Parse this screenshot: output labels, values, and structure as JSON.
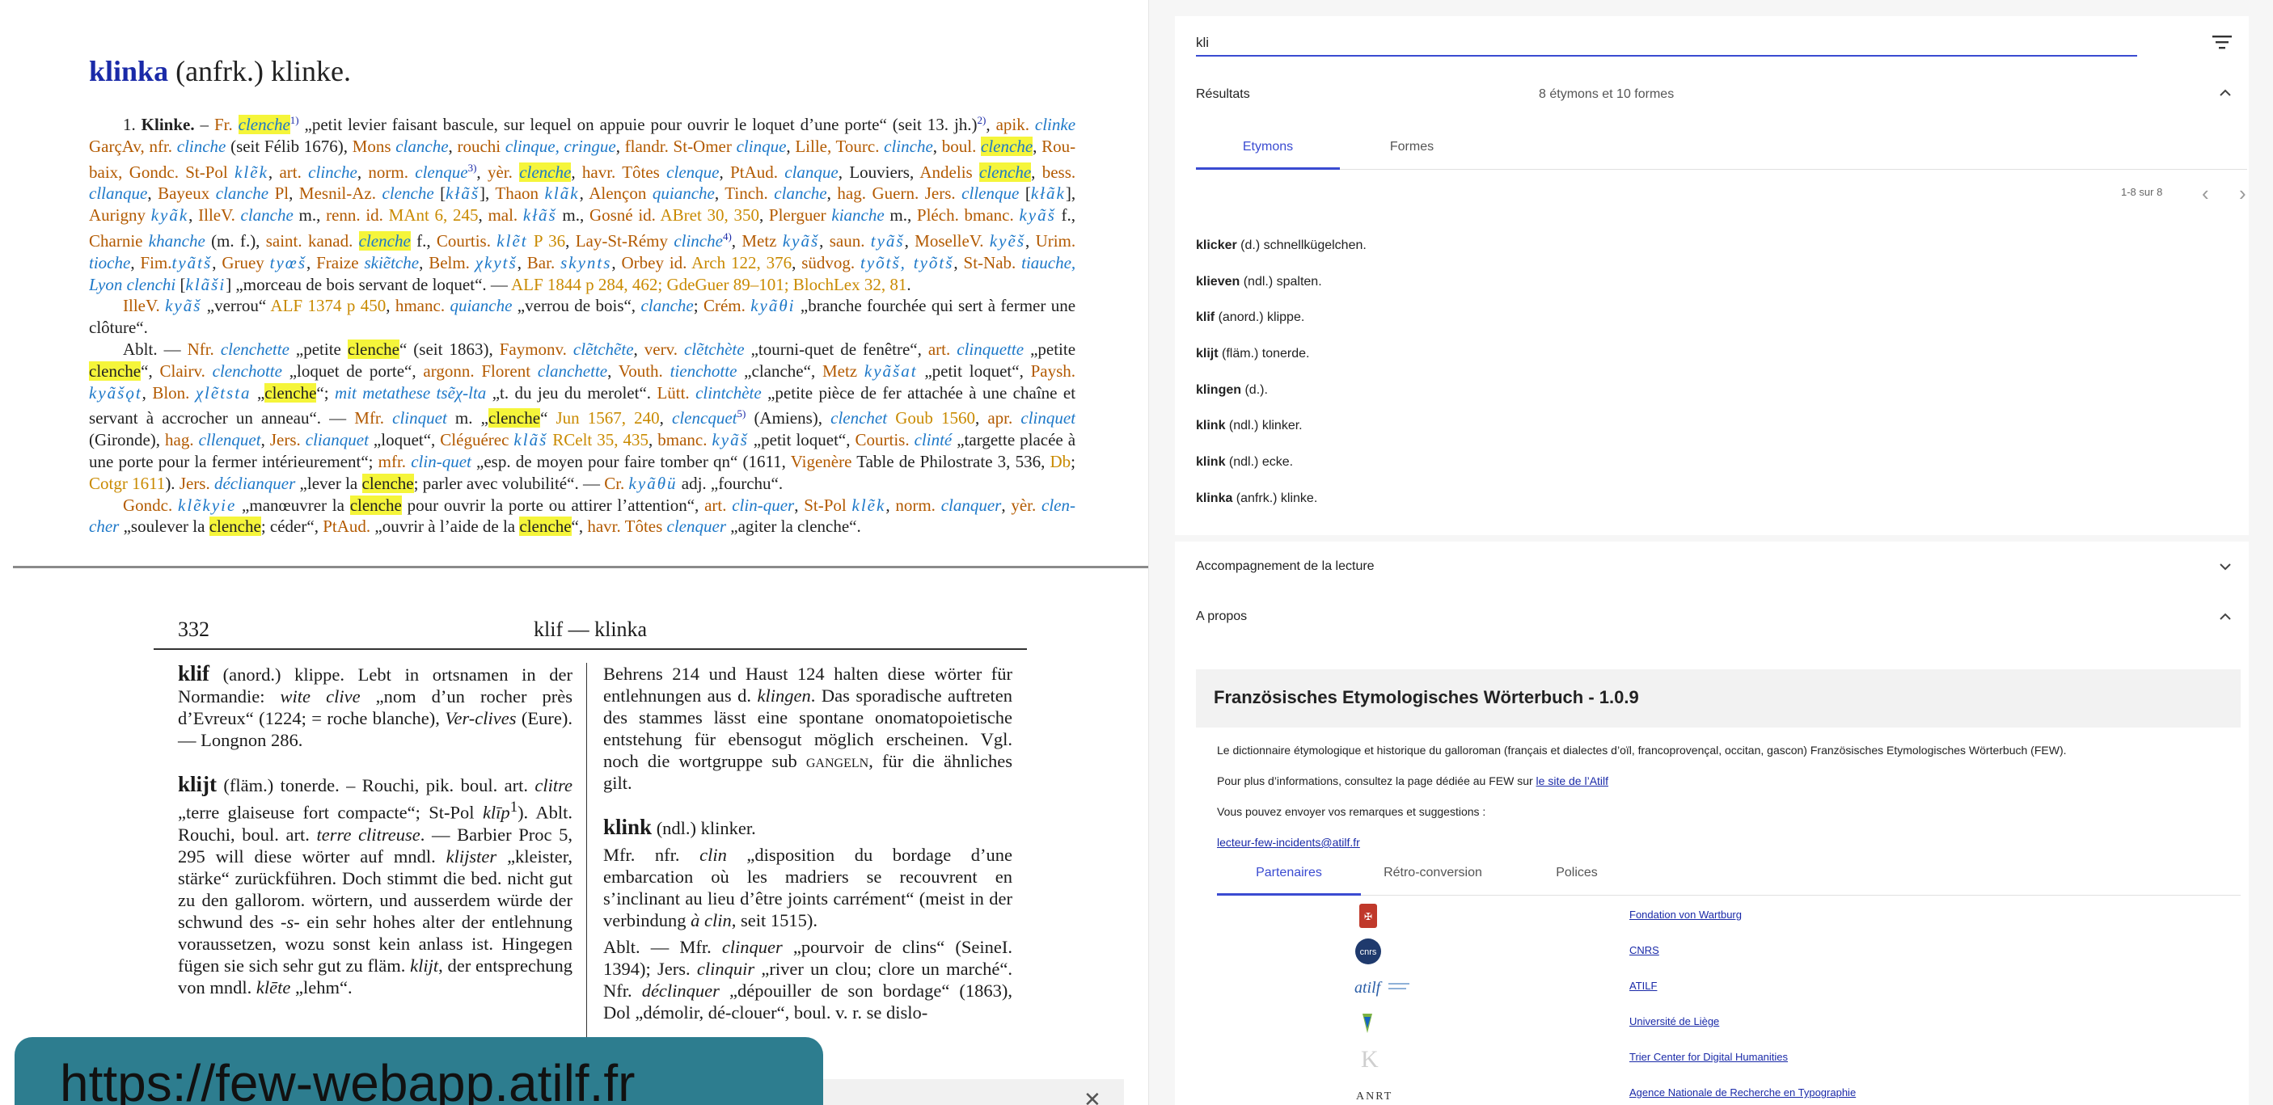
{
  "search": {
    "value": "kli"
  },
  "results": {
    "title": "Résultats",
    "count": "8 étymons et 10 formes",
    "tabs": [
      "Etymons",
      "Formes"
    ],
    "pager": "1-8 sur 8",
    "etymons": [
      {
        "hw": "klicker",
        "rest": " (d.) schnellkügelchen."
      },
      {
        "hw": "klieven",
        "rest": " (ndl.) spalten."
      },
      {
        "hw": "klif",
        "rest": " (anord.) klippe."
      },
      {
        "hw": "klijt",
        "rest": " (fläm.) tonerde."
      },
      {
        "hw": "klingen",
        "rest": " (d.)."
      },
      {
        "hw": "klink",
        "rest": " (ndl.) klinker."
      },
      {
        "hw": "klink",
        "rest": " (ndl.) ecke."
      },
      {
        "hw": "klinka",
        "rest": " (anfrk.) klinke."
      }
    ]
  },
  "accompagnement": {
    "title": "Accompagnement de la lecture"
  },
  "apropos": {
    "title": "A propos",
    "box_title": "Französisches Etymologisches Wörterbuch - 1.0.9",
    "line1": "Le dictionnaire étymologique et historique du galloroman (français et dialectes d’oïl, francoprovençal, occitan, gascon) Französisches Etymologisches Wörterbuch (FEW).",
    "line2_pre": "Pour plus d’informations, consultez la page dédiée au FEW sur ",
    "line2_link": "le site de l’Atilf",
    "line3": "Vous pouvez envoyer vos remarques et suggestions :",
    "email": "lecteur-few-incidents@atilf.fr",
    "tabs": [
      "Partenaires",
      "Rétro-conversion",
      "Polices"
    ],
    "partners": [
      "Fondation von Wartburg",
      "CNRS",
      "ATILF",
      "Université de Liège",
      "Trier Center for Digital Humanities",
      "Agence Nationale de Recherche en Typographie"
    ],
    "logo_texts": [
      "cnrs",
      "atilf",
      "ANRT"
    ]
  },
  "article": {
    "hw": "klinka",
    "rest": " (anfrk.) klinke."
  },
  "scan": {
    "page": "332",
    "running_head": "klif — klinka",
    "col1_hw1": "klif",
    "col1_hw1_rest": " (anord.) klippe.",
    "col1_hw2": "klijt",
    "col1_hw2_rest": " (fläm.) tonerde.",
    "col2_hw": "klink",
    "col2_hw_rest": " (ndl.) klinker."
  },
  "banner": {
    "url": "https://few-webapp.atilf.fr"
  },
  "colors": {
    "accent": "#3a4bd1",
    "headword": "#1a2aa8",
    "highlight": "#f5f53a",
    "banner": "#2d7d8f",
    "orange": "#b35a00",
    "blue_form": "#1d78c8"
  }
}
